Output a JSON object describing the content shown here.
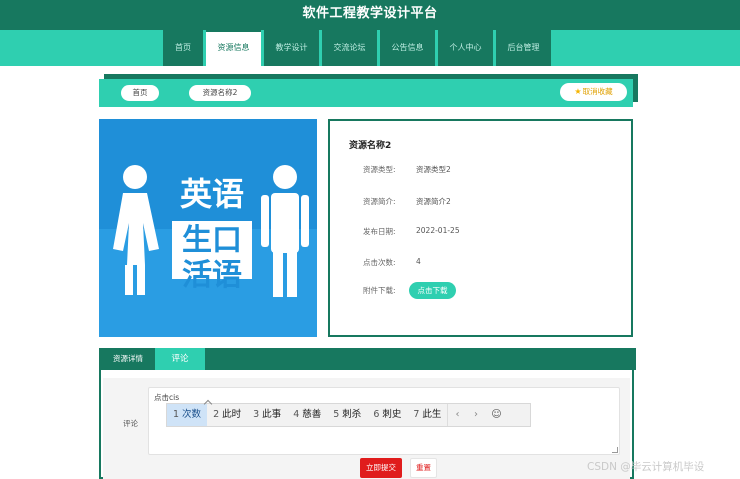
{
  "header": {
    "title": "软件工程教学设计平台"
  },
  "nav": {
    "items": [
      {
        "label": "首页"
      },
      {
        "label": "资源信息"
      },
      {
        "label": "教学设计"
      },
      {
        "label": "交流论坛"
      },
      {
        "label": "公告信息"
      },
      {
        "label": "个人中心"
      },
      {
        "label": "后台管理"
      }
    ],
    "active": "资源信息"
  },
  "breadcrumb": {
    "home": "首页",
    "current": "资源名称2",
    "favorite_label": "取消收藏"
  },
  "poster": {
    "lines": [
      "英语",
      "生口",
      "活语"
    ],
    "bg_color": "#1f8fd8"
  },
  "resource": {
    "name": "资源名称2",
    "fields": [
      {
        "label": "资源类型:",
        "value": "资源类型2"
      },
      {
        "label": "资源简介:",
        "value": "资源简介2"
      },
      {
        "label": "发布日期:",
        "value": "2022-01-25"
      },
      {
        "label": "点击次数:",
        "value": "4"
      }
    ],
    "attachment_label": "附件下载:",
    "download_label": "点击下载"
  },
  "tabs": [
    {
      "label": "资源详情"
    },
    {
      "label": "评论"
    }
  ],
  "comment": {
    "label": "评论",
    "typed": "点击cis",
    "submit_label": "立即提交",
    "reset_label": "重置"
  },
  "ime": {
    "candidates": [
      {
        "num": "1",
        "text": "次数"
      },
      {
        "num": "2",
        "text": "此时"
      },
      {
        "num": "3",
        "text": "此事"
      },
      {
        "num": "4",
        "text": "慈善"
      },
      {
        "num": "5",
        "text": "刺杀"
      },
      {
        "num": "6",
        "text": "刺史"
      },
      {
        "num": "7",
        "text": "此生"
      }
    ],
    "prev": "‹",
    "next": "›",
    "emoji": "☺"
  },
  "watermark": "CSDN @毕云计算机毕设",
  "colors": {
    "dark_green": "#17785f",
    "teal": "#2fcfb0",
    "red": "#e01c1c"
  }
}
